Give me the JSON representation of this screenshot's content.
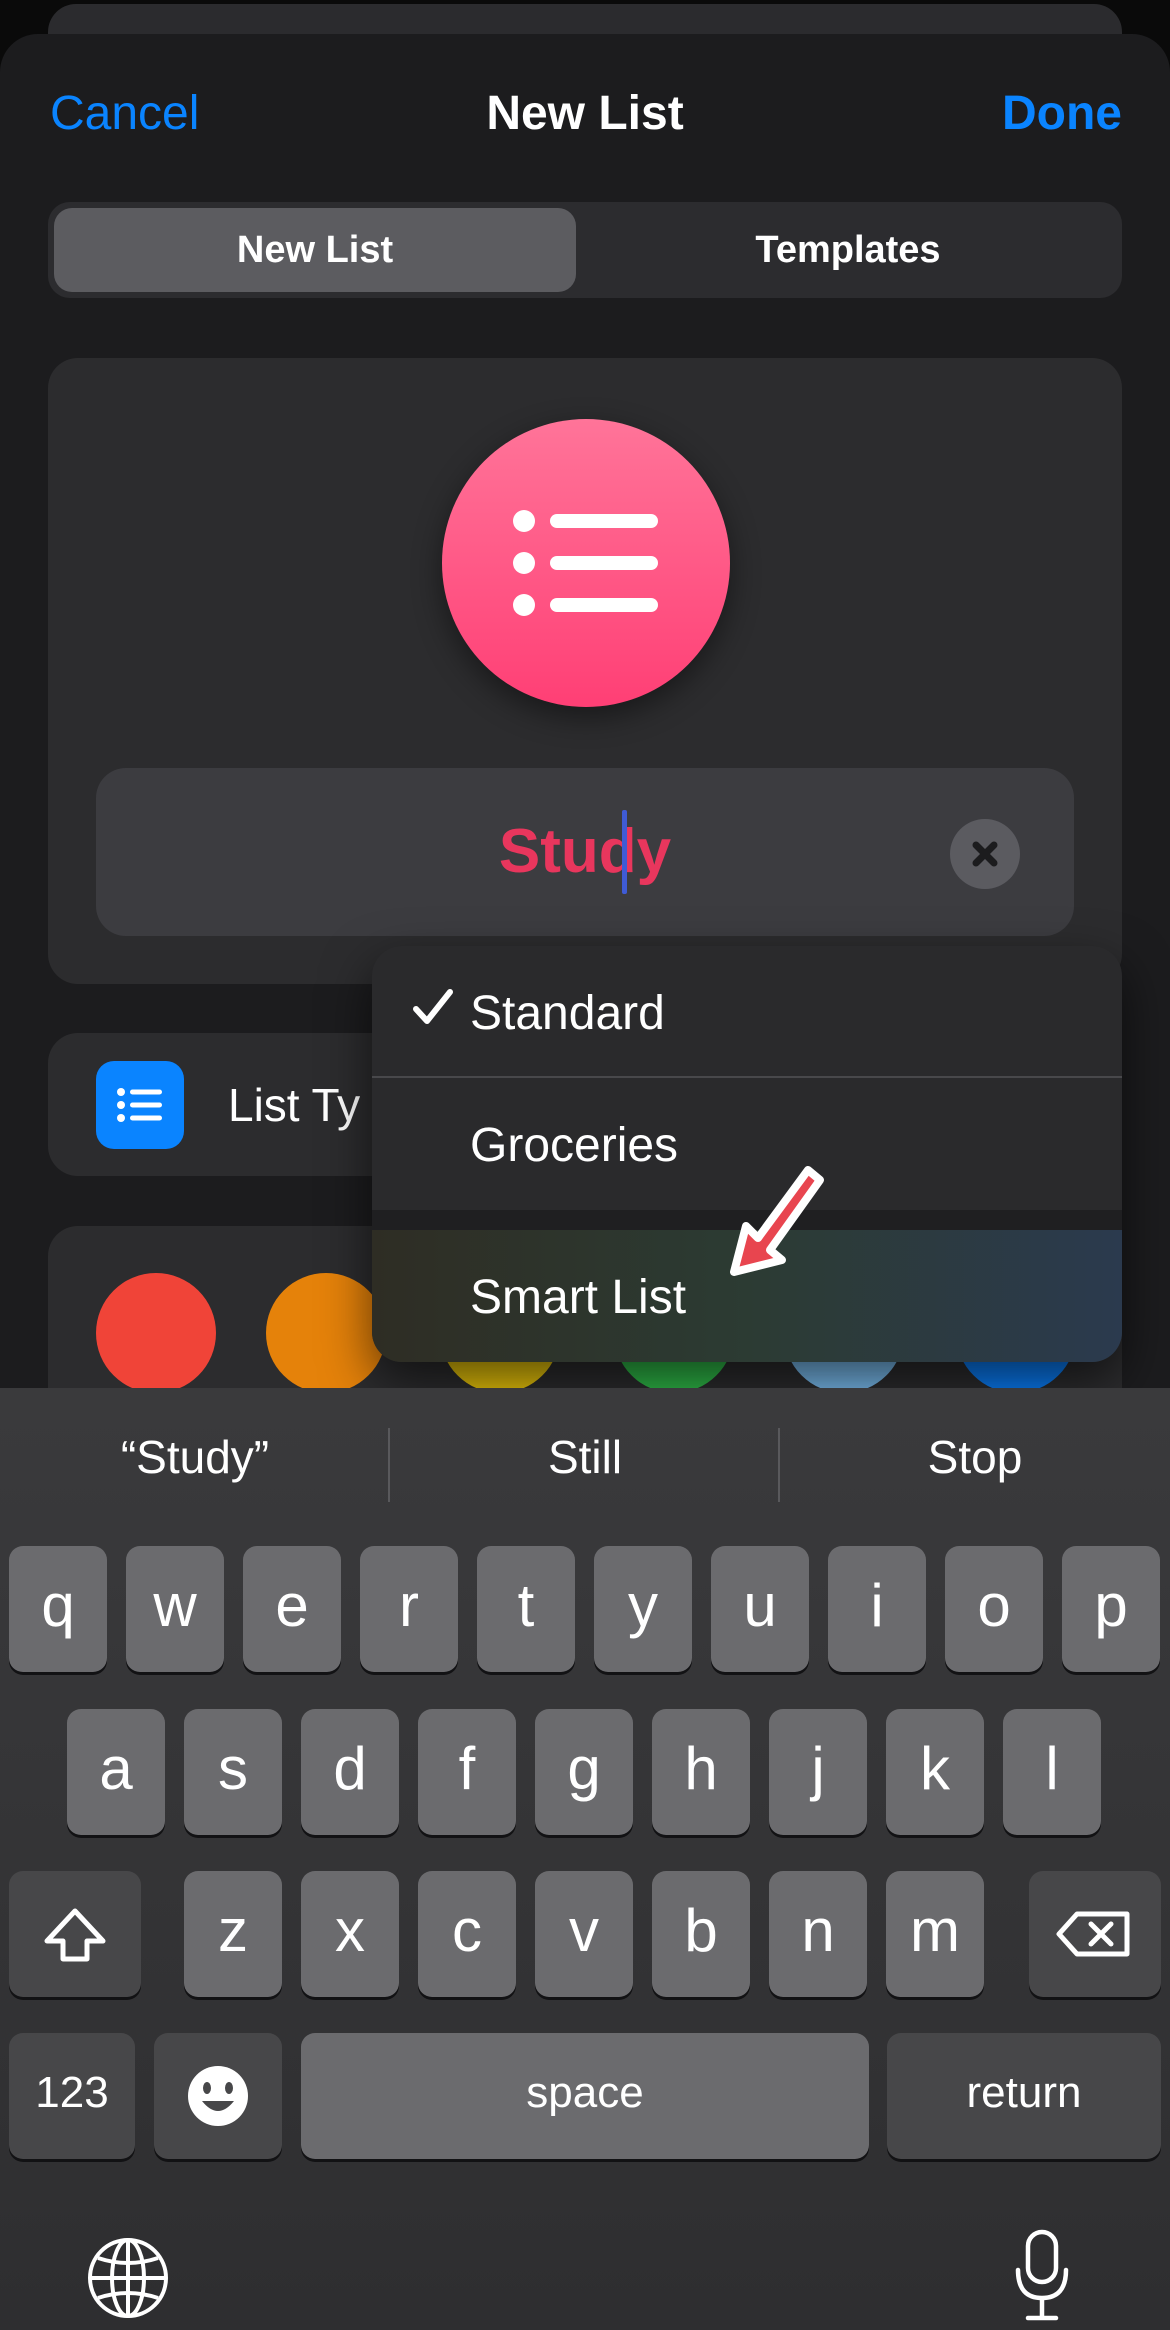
{
  "nav": {
    "cancel": "Cancel",
    "title": "New List",
    "done": "Done"
  },
  "segments": [
    "New List",
    "Templates"
  ],
  "list": {
    "icon": "list-bullet-icon",
    "icon_color": "#ff4f7f",
    "name_value": "Study",
    "name_color": "#e8365d"
  },
  "list_type_row": {
    "label": "List Ty",
    "icon": "list-bullet-icon"
  },
  "colors": [
    "#f04438",
    "#e5820a",
    "#e9c40a",
    "#2fba48",
    "#7abdf0",
    "#0a7cf5"
  ],
  "menu": {
    "items": [
      {
        "label": "Standard",
        "checked": true
      },
      {
        "label": "Groceries",
        "checked": false
      },
      {
        "label": "Smart List",
        "checked": false
      }
    ]
  },
  "keyboard": {
    "suggestions": [
      "“Study”",
      "Still",
      "Stop"
    ],
    "row1": [
      "q",
      "w",
      "e",
      "r",
      "t",
      "y",
      "u",
      "i",
      "o",
      "p"
    ],
    "row2": [
      "a",
      "s",
      "d",
      "f",
      "g",
      "h",
      "j",
      "k",
      "l"
    ],
    "row3": [
      "z",
      "x",
      "c",
      "v",
      "b",
      "n",
      "m"
    ],
    "numbers_key": "123",
    "space_key": "space",
    "return_key": "return"
  },
  "accent": "#0a84ff"
}
